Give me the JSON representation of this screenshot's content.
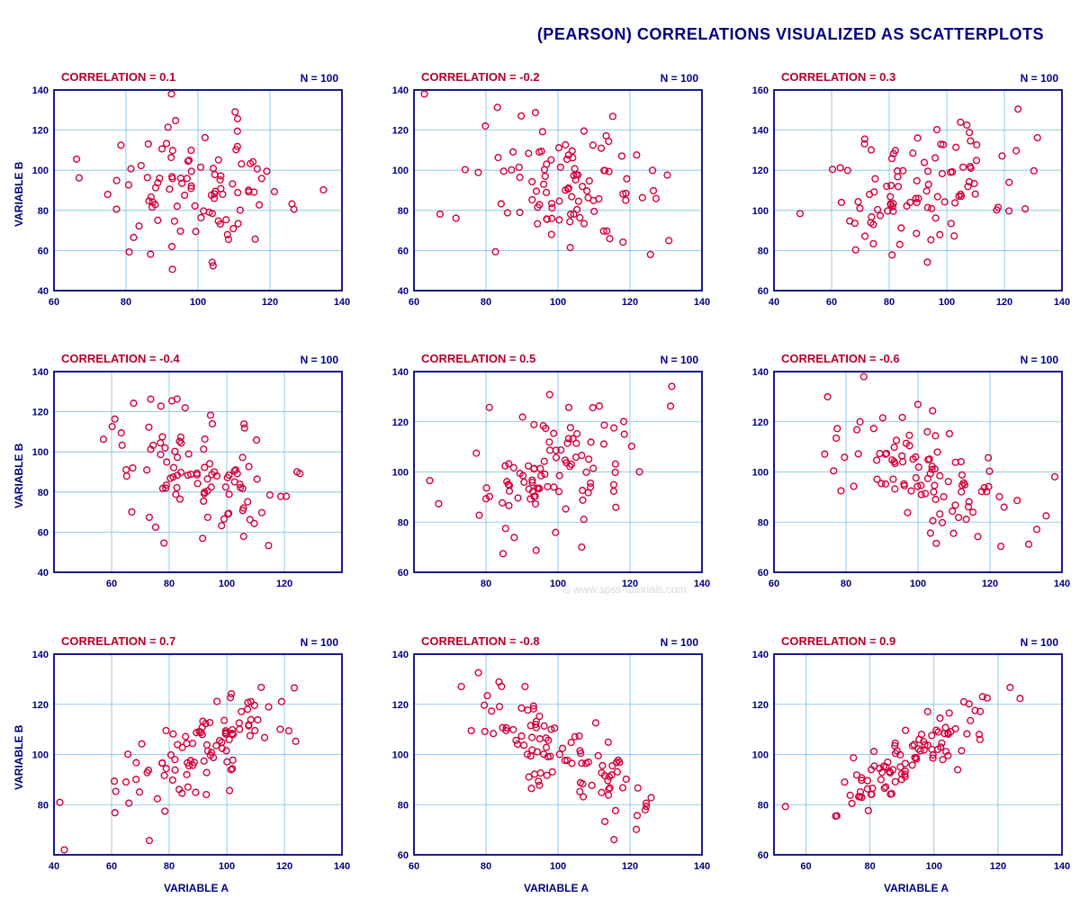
{
  "title": "(PEARSON) CORRELATIONS VISUALIZED AS SCATTERPLOTS",
  "ylabel": "VARIABLE B",
  "xlabel": "VARIABLE A",
  "n_label_prefix": "N = ",
  "corr_label_prefix": "CORRELATION = ",
  "watermark": "© www.spss-tutorials.com",
  "colors": {
    "title": "#000080",
    "label": "#b5002c",
    "axis": "#000080",
    "grid": "#79bde8",
    "point_stroke": "#d4003a"
  },
  "chart_data": [
    {
      "type": "scatter",
      "correlation": 0.1,
      "n": 100,
      "show_ylabel": true,
      "show_xlabel": false,
      "xlim": [
        60,
        140
      ],
      "ylim": [
        40,
        140
      ],
      "xticks": [
        60,
        80,
        100,
        120,
        140
      ],
      "yticks": [
        40,
        60,
        80,
        100,
        120,
        140
      ]
    },
    {
      "type": "scatter",
      "correlation": -0.2,
      "n": 100,
      "show_ylabel": false,
      "show_xlabel": false,
      "xlim": [
        60,
        140
      ],
      "ylim": [
        40,
        140
      ],
      "xticks": [
        60,
        80,
        100,
        120,
        140
      ],
      "yticks": [
        40,
        60,
        80,
        100,
        120,
        140
      ]
    },
    {
      "type": "scatter",
      "correlation": 0.3,
      "n": 100,
      "show_ylabel": false,
      "show_xlabel": false,
      "xlim": [
        40,
        140
      ],
      "ylim": [
        60,
        160
      ],
      "xticks": [
        40,
        60,
        80,
        100,
        120,
        140
      ],
      "yticks": [
        60,
        80,
        100,
        120,
        140,
        160
      ]
    },
    {
      "type": "scatter",
      "correlation": -0.4,
      "n": 100,
      "show_ylabel": true,
      "show_xlabel": false,
      "xlim": [
        40,
        140
      ],
      "ylim": [
        40,
        140
      ],
      "xticks": [
        60,
        80,
        100,
        120
      ],
      "yticks": [
        40,
        60,
        80,
        100,
        120,
        140
      ]
    },
    {
      "type": "scatter",
      "correlation": 0.5,
      "n": 100,
      "show_ylabel": false,
      "show_xlabel": false,
      "xlim": [
        60,
        140
      ],
      "ylim": [
        60,
        140
      ],
      "xticks": [
        80,
        100,
        120,
        140
      ],
      "yticks": [
        60,
        80,
        100,
        120,
        140
      ]
    },
    {
      "type": "scatter",
      "correlation": -0.6,
      "n": 100,
      "show_ylabel": false,
      "show_xlabel": false,
      "xlim": [
        60,
        140
      ],
      "ylim": [
        60,
        140
      ],
      "xticks": [
        60,
        80,
        100,
        120,
        140
      ],
      "yticks": [
        60,
        80,
        100,
        120,
        140
      ]
    },
    {
      "type": "scatter",
      "correlation": 0.7,
      "n": 100,
      "show_ylabel": true,
      "show_xlabel": true,
      "xlim": [
        40,
        140
      ],
      "ylim": [
        60,
        140
      ],
      "xticks": [
        40,
        60,
        80,
        100,
        120,
        140
      ],
      "yticks": [
        80,
        100,
        120,
        140
      ]
    },
    {
      "type": "scatter",
      "correlation": -0.8,
      "n": 100,
      "show_ylabel": false,
      "show_xlabel": true,
      "xlim": [
        60,
        140
      ],
      "ylim": [
        60,
        140
      ],
      "xticks": [
        60,
        80,
        100,
        120,
        140
      ],
      "yticks": [
        60,
        80,
        100,
        120,
        140
      ]
    },
    {
      "type": "scatter",
      "correlation": 0.9,
      "n": 100,
      "show_ylabel": false,
      "show_xlabel": true,
      "xlim": [
        50,
        140
      ],
      "ylim": [
        60,
        140
      ],
      "xticks": [
        60,
        80,
        100,
        120,
        140
      ],
      "yticks": [
        60,
        80,
        100,
        120,
        140
      ]
    }
  ]
}
